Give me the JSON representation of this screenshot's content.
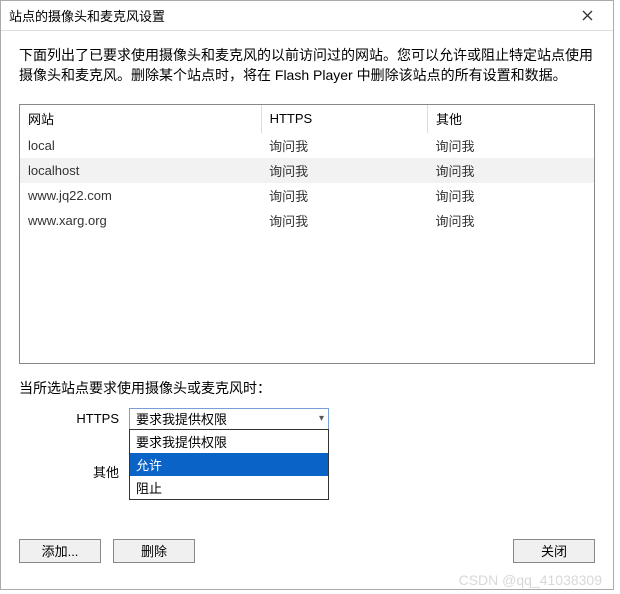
{
  "title": "站点的摄像头和麦克风设置",
  "description": "下面列出了已要求使用摄像头和麦克风的以前访问过的网站。您可以允许或阻止特定站点使用摄像头和麦克风。删除某个站点时，将在 Flash Player 中删除该站点的所有设置和数据。",
  "table": {
    "headers": {
      "site": "网站",
      "https": "HTTPS",
      "other": "其他"
    },
    "rows": [
      {
        "site": "local",
        "https": "询问我",
        "other": "询问我",
        "selected": false
      },
      {
        "site": "localhost",
        "https": "询问我",
        "other": "询问我",
        "selected": true
      },
      {
        "site": "www.jq22.com",
        "https": "询问我",
        "other": "询问我",
        "selected": false
      },
      {
        "site": "www.xarg.org",
        "https": "询问我",
        "other": "询问我",
        "selected": false
      }
    ]
  },
  "form": {
    "heading": "当所选站点要求使用摄像头或麦克风时：",
    "https_label": "HTTPS",
    "other_label": "其他",
    "https_value": "要求我提供权限",
    "dropdown_options": [
      "要求我提供权限",
      "允许",
      "阻止"
    ],
    "dropdown_highlight_index": 1
  },
  "buttons": {
    "add": "添加...",
    "delete": "删除",
    "close": "关闭"
  },
  "watermark": "CSDN @qq_41038309"
}
